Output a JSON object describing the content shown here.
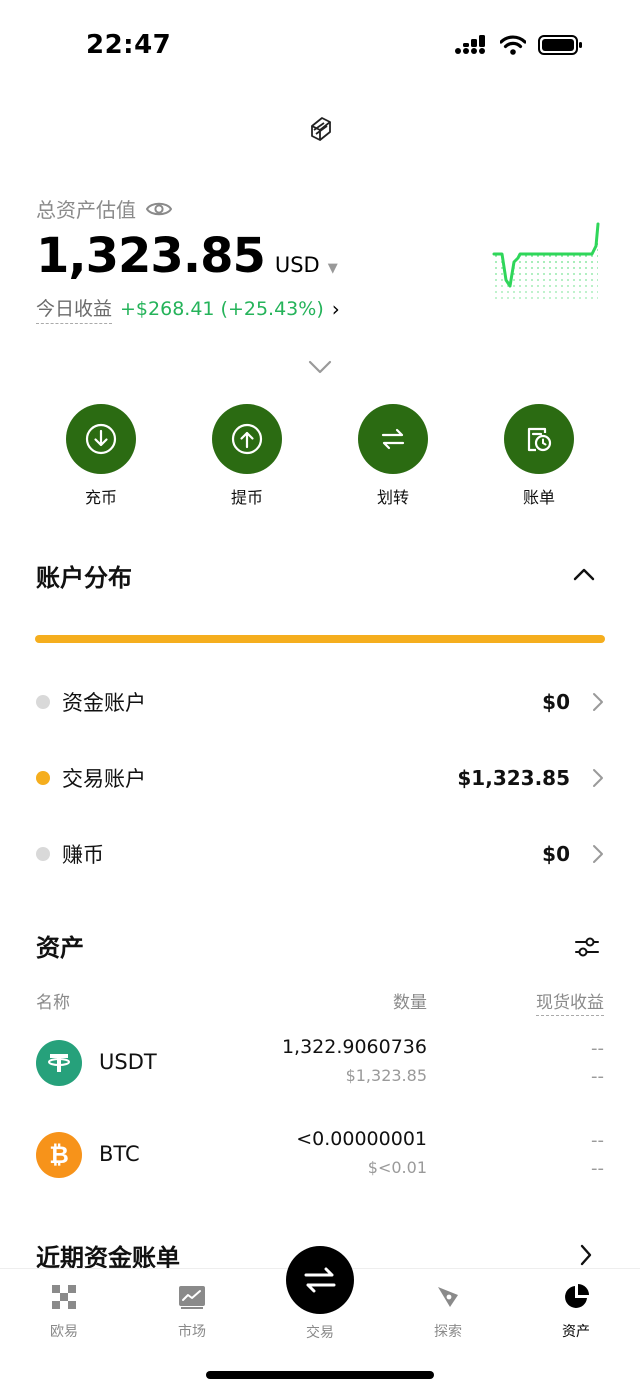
{
  "status_bar": {
    "time": "22:47"
  },
  "header": {
    "total_label": "总资产估值",
    "total_value": "1,323.85",
    "currency": "USD",
    "today_label": "今日收益",
    "today_value": "+$268.41 (+25.43%)",
    "today_arrow": "›"
  },
  "actions": [
    {
      "label": "充币",
      "icon": "deposit-icon"
    },
    {
      "label": "提币",
      "icon": "withdraw-icon"
    },
    {
      "label": "划转",
      "icon": "transfer-icon"
    },
    {
      "label": "账单",
      "icon": "bill-icon"
    }
  ],
  "account_distribution": {
    "title": "账户分布",
    "bar_color": "#f5ae1e",
    "accounts": [
      {
        "name": "资金账户",
        "amount": "$0",
        "dot_color": "#d9d9d9"
      },
      {
        "name": "交易账户",
        "amount": "$1,323.85",
        "dot_color": "#f5ae1e"
      },
      {
        "name": "赚币",
        "amount": "$0",
        "dot_color": "#d9d9d9"
      }
    ]
  },
  "assets": {
    "title": "资产",
    "columns": {
      "name": "名称",
      "quantity": "数量",
      "pnl": "现货收益"
    },
    "rows": [
      {
        "symbol": "USDT",
        "quantity": "1,322.9060736",
        "usd": "$1,323.85",
        "pnl1": "--",
        "pnl2": "--",
        "coin_color": "#26a17b",
        "coin_glyph": "T"
      },
      {
        "symbol": "BTC",
        "quantity": "<0.00000001",
        "usd": "$<0.01",
        "pnl1": "--",
        "pnl2": "--",
        "coin_color": "#f7931a",
        "coin_glyph": "₿"
      }
    ]
  },
  "recent": {
    "title": "近期资金账单"
  },
  "tabbar": {
    "tabs": [
      {
        "label": "欧易",
        "icon": "okx-logo-icon"
      },
      {
        "label": "市场",
        "icon": "market-chart-icon"
      },
      {
        "label": "交易",
        "icon": "trade-swap-icon"
      },
      {
        "label": "探索",
        "icon": "explore-compass-icon"
      },
      {
        "label": "资产",
        "icon": "assets-pie-icon"
      }
    ],
    "active": "资产"
  },
  "colors": {
    "accent_green": "#2b6b12",
    "profit_green": "#25b35a",
    "sparkline_green": "#2fd65a"
  }
}
